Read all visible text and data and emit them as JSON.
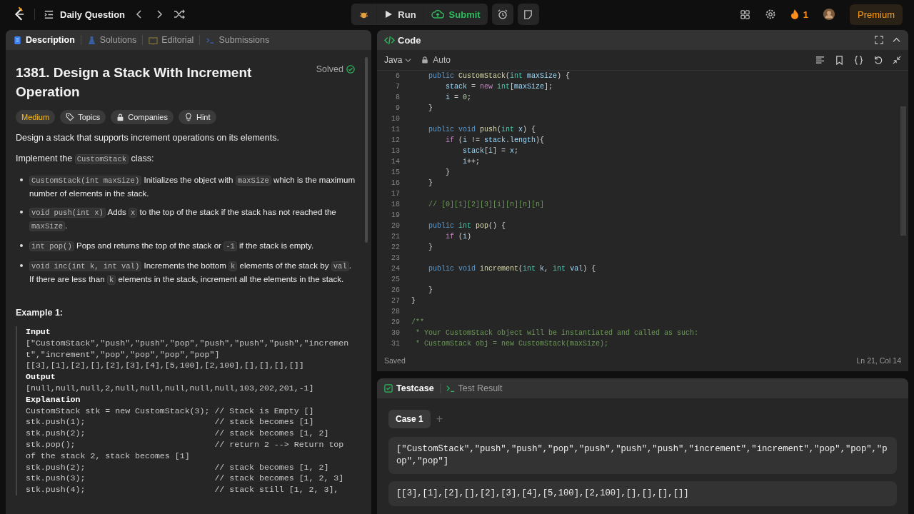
{
  "topbar": {
    "title": "Daily Question",
    "run": "Run",
    "submit": "Submit",
    "streak": "1",
    "premium": "Premium"
  },
  "left_panel": {
    "tabs": [
      {
        "kind": "description",
        "label": "Description",
        "selected": true
      },
      {
        "kind": "solutions",
        "label": "Solutions",
        "selected": false
      },
      {
        "kind": "editorial",
        "label": "Editorial",
        "selected": false
      },
      {
        "kind": "submissions",
        "label": "Submissions",
        "selected": false
      }
    ],
    "title": "1381. Design a Stack With Increment Operation",
    "status": "Solved",
    "tags": [
      {
        "kind": "difficulty",
        "label": "Medium"
      },
      {
        "kind": "topics",
        "label": "Topics"
      },
      {
        "kind": "companies",
        "label": "Companies"
      },
      {
        "kind": "hint",
        "label": "Hint"
      }
    ],
    "paragraphs": [
      [
        {
          "kind": "text",
          "text": "Design a stack that supports increment operations on its elements."
        }
      ],
      [
        {
          "kind": "text",
          "text": "Implement the "
        },
        {
          "kind": "code",
          "text": "CustomStack"
        },
        {
          "kind": "text",
          "text": " class:"
        }
      ]
    ],
    "bullets": [
      [
        {
          "kind": "code",
          "text": "CustomStack(int maxSize)"
        },
        {
          "kind": "text",
          "text": " Initializes the object with "
        },
        {
          "kind": "code",
          "text": "maxSize"
        },
        {
          "kind": "text",
          "text": " which is the maximum number of elements in the stack."
        }
      ],
      [
        {
          "kind": "code",
          "text": "void push(int x)"
        },
        {
          "kind": "text",
          "text": " Adds "
        },
        {
          "kind": "code",
          "text": "x"
        },
        {
          "kind": "text",
          "text": " to the top of the stack if the stack has not reached the "
        },
        {
          "kind": "code",
          "text": "maxSize"
        },
        {
          "kind": "text",
          "text": "."
        }
      ],
      [
        {
          "kind": "code",
          "text": "int pop()"
        },
        {
          "kind": "text",
          "text": " Pops and returns the top of the stack or "
        },
        {
          "kind": "code",
          "text": "-1"
        },
        {
          "kind": "text",
          "text": " if the stack is empty."
        }
      ],
      [
        {
          "kind": "code",
          "text": "void inc(int k, int val)"
        },
        {
          "kind": "text",
          "text": " Increments the bottom "
        },
        {
          "kind": "code",
          "text": "k"
        },
        {
          "kind": "text",
          "text": " elements of the stack by "
        },
        {
          "kind": "code",
          "text": "val"
        },
        {
          "kind": "text",
          "text": ". If there are less than "
        },
        {
          "kind": "code",
          "text": "k"
        },
        {
          "kind": "text",
          "text": " elements in the stack, increment all the elements in the stack."
        }
      ]
    ],
    "example_title": "Example 1:",
    "example_lines": [
      {
        "kind": "heading",
        "text": "Input"
      },
      {
        "kind": "text",
        "text": "[\"CustomStack\",\"push\",\"push\",\"pop\",\"push\",\"push\",\"push\",\"incremen"
      },
      {
        "kind": "text",
        "text": "t\",\"increment\",\"pop\",\"pop\",\"pop\",\"pop\"]"
      },
      {
        "kind": "text",
        "text": "[[3],[1],[2],[],[2],[3],[4],[5,100],[2,100],[],[],[],[]]"
      },
      {
        "kind": "heading",
        "text": "Output"
      },
      {
        "kind": "text",
        "text": "[null,null,null,2,null,null,null,null,null,103,202,201,-1]"
      },
      {
        "kind": "heading",
        "text": "Explanation"
      },
      {
        "kind": "text",
        "text": "CustomStack stk = new CustomStack(3); // Stack is Empty []"
      },
      {
        "kind": "text",
        "text": "stk.push(1);                          // stack becomes [1]"
      },
      {
        "kind": "text",
        "text": "stk.push(2);                          // stack becomes [1, 2]"
      },
      {
        "kind": "text",
        "text": "stk.pop();                            // return 2 --> Return top"
      },
      {
        "kind": "text",
        "text": "of the stack 2, stack becomes [1]"
      },
      {
        "kind": "text",
        "text": "stk.push(2);                          // stack becomes [1, 2]"
      },
      {
        "kind": "text",
        "text": "stk.push(3);                          // stack becomes [1, 2, 3]"
      },
      {
        "kind": "text",
        "text": "stk.push(4);                          // stack still [1, 2, 3],"
      }
    ]
  },
  "code_panel": {
    "title": "Code",
    "language": "Java",
    "mode": "Auto",
    "lines": [
      {
        "number": "6",
        "tokens": [
          {
            "kind": "keyword",
            "text": "    public"
          },
          {
            "kind": "function",
            "text": " CustomStack"
          },
          {
            "kind": "plain",
            "text": "("
          },
          {
            "kind": "type",
            "text": "int"
          },
          {
            "kind": "variable",
            "text": " maxSize"
          },
          {
            "kind": "plain",
            "text": ") {"
          }
        ]
      },
      {
        "number": "7",
        "tokens": [
          {
            "kind": "variable",
            "text": "        stack"
          },
          {
            "kind": "plain",
            "text": " = "
          },
          {
            "kind": "control",
            "text": "new"
          },
          {
            "kind": "type",
            "text": " int"
          },
          {
            "kind": "plain",
            "text": "["
          },
          {
            "kind": "variable",
            "text": "maxSize"
          },
          {
            "kind": "plain",
            "text": "];"
          }
        ]
      },
      {
        "number": "8",
        "tokens": [
          {
            "kind": "variable",
            "text": "        i"
          },
          {
            "kind": "plain",
            "text": " = "
          },
          {
            "kind": "number",
            "text": "0"
          },
          {
            "kind": "plain",
            "text": ";"
          }
        ]
      },
      {
        "number": "9",
        "tokens": [
          {
            "kind": "plain",
            "text": "    }"
          }
        ]
      },
      {
        "number": "10"
      },
      {
        "number": "11",
        "tokens": [
          {
            "kind": "keyword",
            "text": "    public"
          },
          {
            "kind": "keyword",
            "text": " void"
          },
          {
            "kind": "function",
            "text": " push"
          },
          {
            "kind": "plain",
            "text": "("
          },
          {
            "kind": "type",
            "text": "int"
          },
          {
            "kind": "variable",
            "text": " x"
          },
          {
            "kind": "plain",
            "text": ") {"
          }
        ]
      },
      {
        "number": "12",
        "tokens": [
          {
            "kind": "control",
            "text": "        if"
          },
          {
            "kind": "plain",
            "text": " ("
          },
          {
            "kind": "variable",
            "text": "i"
          },
          {
            "kind": "plain",
            "text": " != "
          },
          {
            "kind": "variable",
            "text": "stack"
          },
          {
            "kind": "plain",
            "text": "."
          },
          {
            "kind": "variable",
            "text": "length"
          },
          {
            "kind": "plain",
            "text": "){"
          }
        ]
      },
      {
        "number": "13",
        "tokens": [
          {
            "kind": "variable",
            "text": "            stack"
          },
          {
            "kind": "plain",
            "text": "["
          },
          {
            "kind": "variable",
            "text": "i"
          },
          {
            "kind": "plain",
            "text": "] = "
          },
          {
            "kind": "variable",
            "text": "x"
          },
          {
            "kind": "plain",
            "text": ";"
          }
        ]
      },
      {
        "number": "14",
        "tokens": [
          {
            "kind": "variable",
            "text": "            i"
          },
          {
            "kind": "plain",
            "text": "++;"
          }
        ]
      },
      {
        "number": "15",
        "tokens": [
          {
            "kind": "plain",
            "text": "        }"
          }
        ]
      },
      {
        "number": "16",
        "tokens": [
          {
            "kind": "plain",
            "text": "    }"
          }
        ]
      },
      {
        "number": "17"
      },
      {
        "number": "18",
        "tokens": [
          {
            "kind": "comment",
            "text": "    // [0][1][2][3][i][n][n][n]"
          }
        ]
      },
      {
        "number": "19"
      },
      {
        "number": "20",
        "tokens": [
          {
            "kind": "keyword",
            "text": "    public"
          },
          {
            "kind": "type",
            "text": " int"
          },
          {
            "kind": "function",
            "text": " pop"
          },
          {
            "kind": "plain",
            "text": "() {"
          }
        ]
      },
      {
        "number": "21",
        "tokens": [
          {
            "kind": "control",
            "text": "        if"
          },
          {
            "kind": "plain",
            "text": " ("
          },
          {
            "kind": "variable",
            "text": "i"
          },
          {
            "kind": "plain",
            "text": ")"
          }
        ]
      },
      {
        "number": "22",
        "tokens": [
          {
            "kind": "plain",
            "text": "    }"
          }
        ]
      },
      {
        "number": "23"
      },
      {
        "number": "24",
        "tokens": [
          {
            "kind": "keyword",
            "text": "    public"
          },
          {
            "kind": "keyword",
            "text": " void"
          },
          {
            "kind": "function",
            "text": " increment"
          },
          {
            "kind": "plain",
            "text": "("
          },
          {
            "kind": "type",
            "text": "int"
          },
          {
            "kind": "variable",
            "text": " k"
          },
          {
            "kind": "plain",
            "text": ", "
          },
          {
            "kind": "type",
            "text": "int"
          },
          {
            "kind": "variable",
            "text": " val"
          },
          {
            "kind": "plain",
            "text": ") {"
          }
        ]
      },
      {
        "number": "25"
      },
      {
        "number": "26",
        "tokens": [
          {
            "kind": "plain",
            "text": "    }"
          }
        ]
      },
      {
        "number": "27",
        "tokens": [
          {
            "kind": "plain",
            "text": "}"
          }
        ]
      },
      {
        "number": "28"
      },
      {
        "number": "29",
        "tokens": [
          {
            "kind": "comment",
            "text": "/**"
          }
        ]
      },
      {
        "number": "30",
        "tokens": [
          {
            "kind": "comment",
            "text": " * Your CustomStack object will be instantiated and called as such:"
          }
        ]
      },
      {
        "number": "31",
        "tokens": [
          {
            "kind": "comment",
            "text": " * CustomStack obj = new CustomStack(maxSize);"
          }
        ]
      }
    ],
    "status": "Saved",
    "cursor": "Ln 21, Col 14"
  },
  "test_panel": {
    "tabs": [
      {
        "kind": "testcase",
        "label": "Testcase",
        "selected": true
      },
      {
        "kind": "result",
        "label": "Test Result",
        "selected": false
      }
    ],
    "cases": [
      {
        "label": "Case 1",
        "selected": true
      }
    ],
    "add": "+",
    "values": [
      "[\"CustomStack\",\"push\",\"push\",\"pop\",\"push\",\"push\",\"push\",\"increment\",\"increment\",\"pop\",\"pop\",\"pop\",\"pop\"]",
      "[[3],[1],[2],[],[2],[3],[4],[5,100],[2,100],[],[],[],[]]"
    ]
  }
}
